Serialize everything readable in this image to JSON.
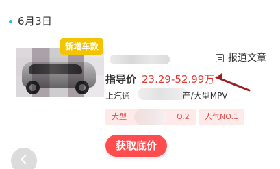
{
  "header": {
    "date": "6月3日"
  },
  "car_card": {
    "badge": "新增车款",
    "price_label": "指导价",
    "price_value": "23.29-52.99万",
    "report_link": "报道文章",
    "brand_prefix": "上汽通",
    "brand_suffix": "产/大型MPV",
    "tags": [
      {
        "left_text": "大型",
        "right_text": "O.2"
      },
      {
        "text": "人气NO.1"
      }
    ],
    "cta": "获取底价"
  },
  "colors": {
    "accent_red": "#ff4d4f",
    "price_red": "#e53935",
    "badge_yellow": "#f5c400",
    "date_dot": "#1ec6c2",
    "tag_bg": "#ffeaea"
  },
  "icons": {
    "report": "document-icon",
    "back": "chevron-left-icon",
    "arrow": "arrow-icon"
  }
}
